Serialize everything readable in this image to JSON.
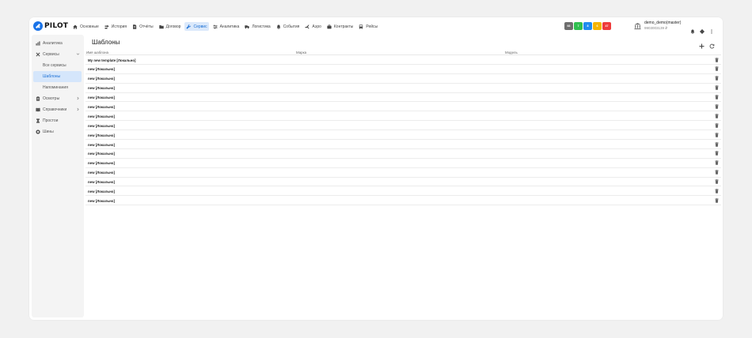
{
  "app": {
    "logo_text": "PILOT"
  },
  "nav": [
    {
      "label": "Основные",
      "icon": "home-icon"
    },
    {
      "label": "История",
      "icon": "route-icon"
    },
    {
      "label": "Отчёты",
      "icon": "document-icon"
    },
    {
      "label": "Договор",
      "icon": "folder-icon"
    },
    {
      "label": "Сервис",
      "icon": "wrench-icon",
      "active": true
    },
    {
      "label": "Аналитика",
      "icon": "sliders-icon"
    },
    {
      "label": "Логистика",
      "icon": "truck-icon"
    },
    {
      "label": "События",
      "icon": "bell-icon"
    },
    {
      "label": "Аэро",
      "icon": "plane-icon"
    },
    {
      "label": "Контракты",
      "icon": "briefcase-icon"
    },
    {
      "label": "Рейсы",
      "icon": "bus-icon"
    }
  ],
  "badges": [
    {
      "label": "66",
      "color": "#6d6d6d"
    },
    {
      "label": "7",
      "color": "#2fbf4f"
    },
    {
      "label": "8",
      "color": "#1f8bf0"
    },
    {
      "label": "6",
      "color": "#f5b400"
    },
    {
      "label": "47",
      "color": "#ee3b3b"
    }
  ],
  "user": {
    "name": "demo_demo(master)",
    "balance": "9903003139 ₽"
  },
  "sidebar": {
    "items": [
      {
        "label": "Аналитика",
        "icon": "chart-icon"
      },
      {
        "label": "Сервисы",
        "icon": "tools-icon",
        "expanded": true,
        "children": [
          {
            "label": "Все сервисы"
          },
          {
            "label": "Шаблоны",
            "active": true
          },
          {
            "label": "Напоминания"
          }
        ]
      },
      {
        "label": "Осмотры",
        "icon": "clipboard-icon",
        "chevron": true
      },
      {
        "label": "Справочники",
        "icon": "book-icon",
        "chevron": true
      },
      {
        "label": "Простои",
        "icon": "hourglass-icon"
      },
      {
        "label": "Шины",
        "icon": "tire-icon"
      }
    ]
  },
  "main": {
    "title": "Шаблоны",
    "columns": [
      "Имя шаблона",
      "Марка",
      "Модель"
    ],
    "rows": [
      {
        "name": "My new template [Локально]",
        "brand": "",
        "model": ""
      },
      {
        "name": "new [Локально]",
        "brand": "",
        "model": ""
      },
      {
        "name": "new [Локально]",
        "brand": "",
        "model": ""
      },
      {
        "name": "new [Локально]",
        "brand": "",
        "model": ""
      },
      {
        "name": "new [Локально]",
        "brand": "",
        "model": ""
      },
      {
        "name": "new [Локально]",
        "brand": "",
        "model": ""
      },
      {
        "name": "new [Локально]",
        "brand": "",
        "model": ""
      },
      {
        "name": "new [Локально]",
        "brand": "",
        "model": ""
      },
      {
        "name": "new [Локально]",
        "brand": "",
        "model": ""
      },
      {
        "name": "new [Локально]",
        "brand": "",
        "model": ""
      },
      {
        "name": "new [Локально]",
        "brand": "",
        "model": ""
      },
      {
        "name": "new [Локально]",
        "brand": "",
        "model": ""
      },
      {
        "name": "new [Локально]",
        "brand": "",
        "model": ""
      },
      {
        "name": "new [Локально]",
        "brand": "",
        "model": ""
      },
      {
        "name": "new [Локально]",
        "brand": "",
        "model": ""
      },
      {
        "name": "new [Локально]",
        "brand": "",
        "model": ""
      }
    ]
  }
}
